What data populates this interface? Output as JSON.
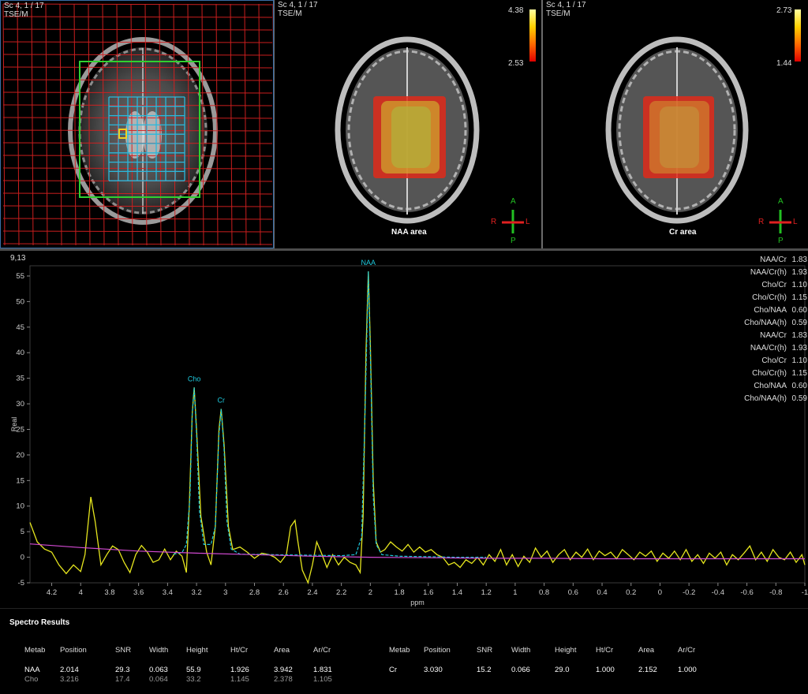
{
  "viewports": [
    {
      "label": "Sc 4, 1 / 17",
      "sublabel": "TSE/M"
    },
    {
      "label": "Sc 4, 1 / 17",
      "sublabel": "TSE/M",
      "title": "NAA area",
      "scale_max": "4.38",
      "scale_min": "2.53"
    },
    {
      "label": "Sc 4, 1 / 17",
      "sublabel": "TSE/M",
      "title": "Cr area",
      "scale_max": "2.73",
      "scale_min": "1.44"
    }
  ],
  "orientation": {
    "top": "A",
    "bottom": "P",
    "left": "R",
    "right": "L"
  },
  "spectrum": {
    "voxel": "9,13"
  },
  "ratios": [
    {
      "label": "NAA/Cr",
      "value": "1.83"
    },
    {
      "label": "NAA/Cr(h)",
      "value": "1.93"
    },
    {
      "label": "Cho/Cr",
      "value": "1.10"
    },
    {
      "label": "Cho/Cr(h)",
      "value": "1.15"
    },
    {
      "label": "Cho/NAA",
      "value": "0.60"
    },
    {
      "label": "Cho/NAA(h)",
      "value": "0.59"
    },
    {
      "label": "NAA/Cr",
      "value": "1.83"
    },
    {
      "label": "NAA/Cr(h)",
      "value": "1.93"
    },
    {
      "label": "Cho/Cr",
      "value": "1.10"
    },
    {
      "label": "Cho/Cr(h)",
      "value": "1.15"
    },
    {
      "label": "Cho/NAA",
      "value": "0.60"
    },
    {
      "label": "Cho/NAA(h)",
      "value": "0.59"
    }
  ],
  "chart_data": {
    "type": "line",
    "xlabel": "ppm",
    "ylabel": "Real",
    "x_reversed": true,
    "xlim": [
      4.35,
      -1.0
    ],
    "ylim": [
      -5,
      57
    ],
    "x_ticks": [
      "4.2",
      "4",
      "3.8",
      "3.6",
      "3.4",
      "3.2",
      "3",
      "2.8",
      "2.6",
      "2.4",
      "2.2",
      "2",
      "1.8",
      "1.6",
      "1.4",
      "1.2",
      "1",
      "0.8",
      "0.6",
      "0.4",
      "0.2",
      "0",
      "-0.2",
      "-0.4",
      "-0.6",
      "-0.8",
      "-1"
    ],
    "y_ticks": [
      "-5",
      "0",
      "5",
      "10",
      "15",
      "20",
      "25",
      "30",
      "35",
      "40",
      "45",
      "50",
      "55"
    ],
    "peaks": [
      {
        "name": "Cho",
        "x": 3.216,
        "y": 33.2
      },
      {
        "name": "Cr",
        "x": 3.03,
        "y": 29.0
      },
      {
        "name": "NAA",
        "x": 2.014,
        "y": 55.9
      }
    ],
    "series": [
      {
        "color": "#e6e61e",
        "points": [
          [
            4.35,
            6.8
          ],
          [
            4.3,
            3.0
          ],
          [
            4.25,
            1.6
          ],
          [
            4.2,
            1.0
          ],
          [
            4.15,
            -1.5
          ],
          [
            4.1,
            -3.2
          ],
          [
            4.05,
            -1.5
          ],
          [
            4.0,
            -2.8
          ],
          [
            3.97,
            0.5
          ],
          [
            3.93,
            11.8
          ],
          [
            3.9,
            7.0
          ],
          [
            3.86,
            -1.5
          ],
          [
            3.82,
            0.5
          ],
          [
            3.78,
            2.2
          ],
          [
            3.74,
            1.5
          ],
          [
            3.7,
            -1.0
          ],
          [
            3.66,
            -3.0
          ],
          [
            3.62,
            0.5
          ],
          [
            3.58,
            2.3
          ],
          [
            3.54,
            1.0
          ],
          [
            3.5,
            -1.0
          ],
          [
            3.46,
            -0.5
          ],
          [
            3.42,
            1.6
          ],
          [
            3.38,
            -0.5
          ],
          [
            3.34,
            1.2
          ],
          [
            3.3,
            0.2
          ],
          [
            3.27,
            -3.0
          ],
          [
            3.25,
            10.0
          ],
          [
            3.23,
            28.0
          ],
          [
            3.216,
            33.2
          ],
          [
            3.2,
            25.0
          ],
          [
            3.17,
            8.0
          ],
          [
            3.13,
            1.0
          ],
          [
            3.1,
            -1.5
          ],
          [
            3.07,
            6.0
          ],
          [
            3.045,
            25.0
          ],
          [
            3.03,
            29.0
          ],
          [
            3.01,
            22.0
          ],
          [
            2.98,
            6.0
          ],
          [
            2.95,
            1.5
          ],
          [
            2.9,
            2.0
          ],
          [
            2.85,
            1.0
          ],
          [
            2.8,
            -0.2
          ],
          [
            2.75,
            0.8
          ],
          [
            2.7,
            0.5
          ],
          [
            2.66,
            0.0
          ],
          [
            2.62,
            -1.0
          ],
          [
            2.58,
            0.5
          ],
          [
            2.55,
            6.0
          ],
          [
            2.52,
            7.2
          ],
          [
            2.5,
            3.0
          ],
          [
            2.47,
            -2.5
          ],
          [
            2.43,
            -5.0
          ],
          [
            2.4,
            -1.5
          ],
          [
            2.37,
            3.0
          ],
          [
            2.34,
            1.0
          ],
          [
            2.3,
            -2.0
          ],
          [
            2.26,
            0.5
          ],
          [
            2.22,
            -1.5
          ],
          [
            2.18,
            0.0
          ],
          [
            2.14,
            -1.0
          ],
          [
            2.1,
            -1.5
          ],
          [
            2.07,
            -3.0
          ],
          [
            2.05,
            8.0
          ],
          [
            2.03,
            40.0
          ],
          [
            2.014,
            55.9
          ],
          [
            2.0,
            42.0
          ],
          [
            1.98,
            15.0
          ],
          [
            1.96,
            3.0
          ],
          [
            1.93,
            1.0
          ],
          [
            1.9,
            1.5
          ],
          [
            1.86,
            3.0
          ],
          [
            1.82,
            2.0
          ],
          [
            1.78,
            1.2
          ],
          [
            1.74,
            2.5
          ],
          [
            1.7,
            1.0
          ],
          [
            1.66,
            2.0
          ],
          [
            1.62,
            1.0
          ],
          [
            1.58,
            1.5
          ],
          [
            1.54,
            0.5
          ],
          [
            1.5,
            0.0
          ],
          [
            1.46,
            -1.5
          ],
          [
            1.42,
            -1.0
          ],
          [
            1.38,
            -2.0
          ],
          [
            1.34,
            -0.5
          ],
          [
            1.3,
            -1.2
          ],
          [
            1.26,
            0.0
          ],
          [
            1.22,
            -1.5
          ],
          [
            1.18,
            0.5
          ],
          [
            1.14,
            -0.8
          ],
          [
            1.1,
            1.5
          ],
          [
            1.06,
            -1.5
          ],
          [
            1.02,
            0.5
          ],
          [
            0.98,
            -1.8
          ],
          [
            0.94,
            0.2
          ],
          [
            0.9,
            -1.0
          ],
          [
            0.86,
            1.8
          ],
          [
            0.82,
            0.0
          ],
          [
            0.78,
            1.2
          ],
          [
            0.74,
            -1.0
          ],
          [
            0.7,
            0.5
          ],
          [
            0.66,
            1.5
          ],
          [
            0.62,
            -0.5
          ],
          [
            0.58,
            1.0
          ],
          [
            0.54,
            0.0
          ],
          [
            0.5,
            1.6
          ],
          [
            0.46,
            -0.5
          ],
          [
            0.42,
            1.2
          ],
          [
            0.38,
            0.3
          ],
          [
            0.34,
            1.0
          ],
          [
            0.3,
            -0.3
          ],
          [
            0.26,
            1.5
          ],
          [
            0.22,
            0.5
          ],
          [
            0.18,
            -0.5
          ],
          [
            0.14,
            1.0
          ],
          [
            0.1,
            0.2
          ],
          [
            0.06,
            1.2
          ],
          [
            0.02,
            -0.8
          ],
          [
            -0.02,
            0.8
          ],
          [
            -0.06,
            -0.2
          ],
          [
            -0.1,
            1.2
          ],
          [
            -0.14,
            -0.5
          ],
          [
            -0.18,
            1.5
          ],
          [
            -0.22,
            -0.8
          ],
          [
            -0.26,
            0.5
          ],
          [
            -0.3,
            -1.2
          ],
          [
            -0.34,
            0.8
          ],
          [
            -0.38,
            -0.2
          ],
          [
            -0.42,
            1.0
          ],
          [
            -0.46,
            -1.5
          ],
          [
            -0.5,
            0.5
          ],
          [
            -0.54,
            -0.5
          ],
          [
            -0.58,
            0.8
          ],
          [
            -0.62,
            2.2
          ],
          [
            -0.66,
            -0.5
          ],
          [
            -0.7,
            1.0
          ],
          [
            -0.74,
            -0.8
          ],
          [
            -0.78,
            1.5
          ],
          [
            -0.82,
            0.0
          ],
          [
            -0.86,
            -0.5
          ],
          [
            -0.9,
            1.0
          ],
          [
            -0.94,
            -1.0
          ],
          [
            -0.98,
            0.5
          ],
          [
            -1.0,
            -1.5
          ]
        ]
      },
      {
        "color": "#1ec8dc",
        "points": [
          [
            3.36,
            0.6
          ],
          [
            3.3,
            0.9
          ],
          [
            3.27,
            2.5
          ],
          [
            3.245,
            12.0
          ],
          [
            3.23,
            28.0
          ],
          [
            3.216,
            33.2
          ],
          [
            3.2,
            24.0
          ],
          [
            3.18,
            9.0
          ],
          [
            3.15,
            2.5
          ],
          [
            3.1,
            2.5
          ],
          [
            3.07,
            6.0
          ],
          [
            3.045,
            24.0
          ],
          [
            3.03,
            29.0
          ],
          [
            3.01,
            21.0
          ],
          [
            2.99,
            7.0
          ],
          [
            2.96,
            1.6
          ],
          [
            2.9,
            0.6
          ],
          [
            2.2,
            0.3
          ],
          [
            2.1,
            0.5
          ],
          [
            2.06,
            4.0
          ],
          [
            2.035,
            30.0
          ],
          [
            2.014,
            55.9
          ],
          [
            2.0,
            40.0
          ],
          [
            1.98,
            12.0
          ],
          [
            1.96,
            2.5
          ],
          [
            1.92,
            0.5
          ],
          [
            1.8,
            0.2
          ],
          [
            1.6,
            0.1
          ],
          [
            1.4,
            0.0
          ],
          [
            1.2,
            0.0
          ]
        ]
      },
      {
        "color": "#d24ad2",
        "points": [
          [
            4.35,
            2.6
          ],
          [
            4.0,
            1.9
          ],
          [
            3.6,
            1.2
          ],
          [
            3.2,
            0.8
          ],
          [
            2.8,
            0.5
          ],
          [
            2.4,
            0.2
          ],
          [
            2.0,
            0.0
          ],
          [
            1.6,
            -0.1
          ],
          [
            1.2,
            -0.2
          ],
          [
            0.8,
            -0.2
          ],
          [
            0.4,
            -0.3
          ],
          [
            0.0,
            -0.3
          ],
          [
            -0.5,
            -0.3
          ],
          [
            -1.0,
            -0.3
          ]
        ]
      }
    ]
  },
  "results": {
    "title": "Spectro Results",
    "headers": [
      "Metab",
      "Position",
      "SNR",
      "Width",
      "Height",
      "Ht/Cr",
      "Area",
      "Ar/Cr"
    ],
    "left_rows": [
      [
        "NAA",
        "2.014",
        "29.3",
        "0.063",
        "55.9",
        "1.926",
        "3.942",
        "1.831"
      ],
      [
        "Cho",
        "3.216",
        "17.4",
        "0.064",
        "33.2",
        "1.145",
        "2.378",
        "1.105"
      ]
    ],
    "right_rows": [
      [
        "Cr",
        "3.030",
        "15.2",
        "0.066",
        "29.0",
        "1.000",
        "2.152",
        "1.000"
      ]
    ]
  },
  "colors": {
    "spectrum_measured": "#e6e61e",
    "spectrum_fit": "#1ec8dc",
    "baseline": "#d24ad2",
    "grid_outer": "#d42020",
    "grid_inner": "#2ab8dc",
    "voi_box": "#30d030",
    "selected_voxel": "#f0d020",
    "viewport_border": "#3a6ea8"
  }
}
